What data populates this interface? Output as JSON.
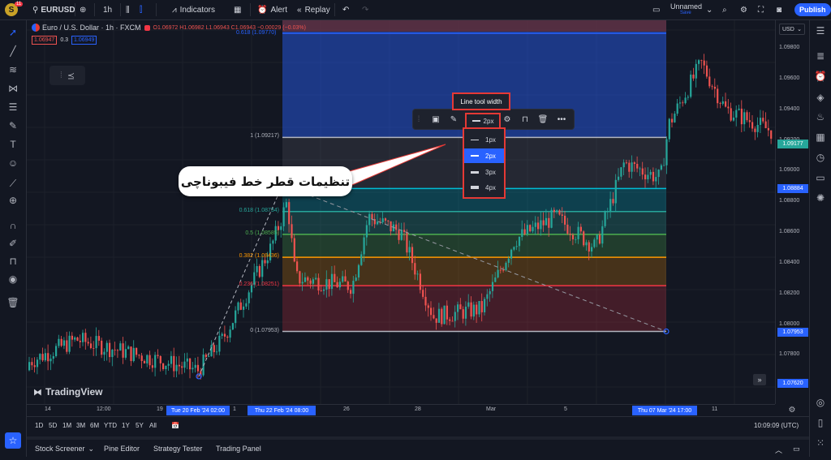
{
  "topbar": {
    "avatar_letter": "S",
    "avatar_badge": "11",
    "symbol": "EURUSD",
    "interval": "1h",
    "indicators": "Indicators",
    "alert": "Alert",
    "replay": "Replay",
    "layout_name": "Unnamed",
    "layout_status": "Save",
    "publish": "Publish"
  },
  "legend": {
    "title": "Euro / U.S. Dollar · 1h · FXCM",
    "ohlc": "O1.06972 H1.06982 L1.06943 C1.06943 −0.00029 (−0.03%)",
    "bid": "1.06947",
    "spread": "0.3",
    "ask": "1.06949"
  },
  "fib": {
    "top": "0.618 (1.09770)",
    "levels": [
      {
        "label": "1 (1.09217)",
        "price": 1.09217,
        "color": "#b2b5be"
      },
      {
        "label": "0.786",
        "price": 1.08884,
        "color": "#00bcd4"
      },
      {
        "label": "0.618 (1.08734)",
        "price": 1.08734,
        "color": "#26a69a"
      },
      {
        "label": "0.5 (1.08585)",
        "price": 1.08585,
        "color": "#4caf50"
      },
      {
        "label": "0.382 (1.08436)",
        "price": 1.08436,
        "color": "#ff9800"
      },
      {
        "label": "0.236 (1.08251)",
        "price": 1.08251,
        "color": "#f23645"
      },
      {
        "label": "0 (1.07953)",
        "price": 1.07953,
        "color": "#b2b5be"
      }
    ]
  },
  "price_axis": {
    "currency": "USD",
    "ticks": [
      "1.09800",
      "1.09600",
      "1.09400",
      "1.09200",
      "1.09000",
      "1.08800",
      "1.08600",
      "1.08400",
      "1.08200",
      "1.08000",
      "1.07800"
    ],
    "badges": [
      {
        "text": "1.09177",
        "color": "#26a69a"
      },
      {
        "text": "1.08884",
        "color": "#2962ff"
      },
      {
        "text": "1.07953",
        "color": "#2962ff"
      },
      {
        "text": "1.07620",
        "color": "#2962ff"
      }
    ]
  },
  "time_axis": {
    "ticks": [
      "14",
      "12:00",
      "19",
      "26",
      "28",
      "Mar",
      "5",
      "11",
      "1"
    ],
    "badges": [
      "Tue 20 Feb '24 02:00",
      "Thu 22 Feb '24 08:00",
      "Thu 07 Mar '24 17:00"
    ]
  },
  "range_bar": {
    "ranges": [
      "1D",
      "5D",
      "1M",
      "3M",
      "6M",
      "YTD",
      "1Y",
      "5Y",
      "All"
    ],
    "clock": "10:09:09 (UTC)"
  },
  "bottom_bar": {
    "tabs": [
      "Stock Screener",
      "Pine Editor",
      "Strategy Tester",
      "Trading Panel"
    ]
  },
  "floating_toolbar": {
    "width_value": "2px",
    "tooltip": "Line tool width",
    "options": [
      "1px",
      "2px",
      "3px",
      "4px"
    ],
    "selected": "2px"
  },
  "callout_text": "تنظیمات قطر خط فیبوناچی",
  "watermark": "TradingView",
  "chart_data": {
    "type": "candlestick",
    "ylim": [
      1.0748,
      1.0998
    ],
    "fib_retracement": {
      "start_price": 1.07953,
      "end_price": 1.09217
    }
  },
  "colors": {
    "up": "#26a69a",
    "down": "#ef5350",
    "accent": "#2962ff",
    "highlight": "#e53935"
  }
}
